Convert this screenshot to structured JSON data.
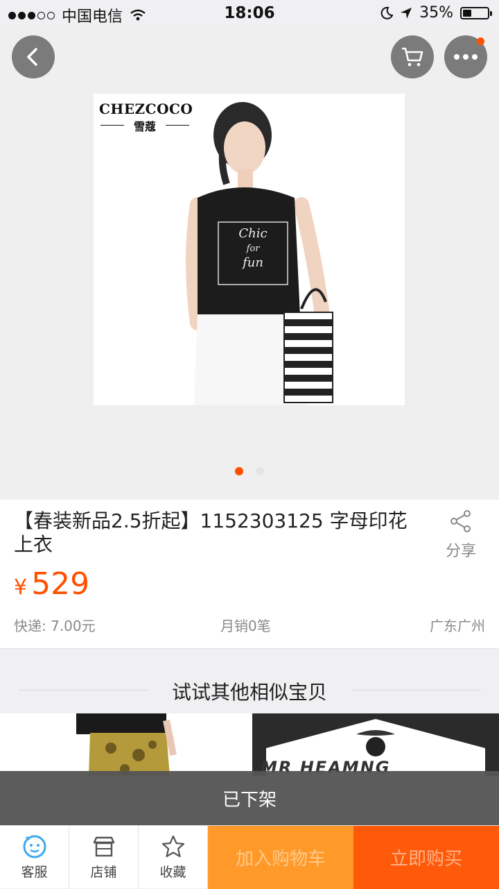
{
  "status_bar": {
    "carrier": "中国电信",
    "time": "18:06",
    "battery_percent": "35%",
    "battery_level": 0.35
  },
  "header": {
    "back_icon": "chevron-left-icon",
    "cart_icon": "cart-icon",
    "more_icon": "more-icon",
    "more_has_notification": true
  },
  "gallery": {
    "brand": "CHEZCOCO",
    "brand_cn": "雪蔻",
    "shirt_text": [
      "Chic",
      "for",
      "fun"
    ],
    "page_count": 2,
    "active_page": 1
  },
  "product": {
    "title": "【春装新品2.5折起】1152303125 字母印花上衣",
    "share_label": "分享",
    "currency": "¥",
    "price": "529",
    "shipping": "快递: 7.00元",
    "monthly_sales": "月销0笔",
    "location": "广东广州"
  },
  "similar": {
    "heading": "试试其他相似宝贝",
    "thumb2_text": "MR HEAMNG"
  },
  "delisted_label": "已下架",
  "bottom_bar": {
    "service_label": "客服",
    "shop_label": "店铺",
    "favorite_label": "收藏",
    "add_cart_label": "加入购物车",
    "buy_now_label": "立即购买"
  },
  "colors": {
    "accent": "#ff5000",
    "cart_button": "#ff9a2a",
    "buy_button": "#ff5a0a",
    "service_icon": "#3aa9f0"
  }
}
